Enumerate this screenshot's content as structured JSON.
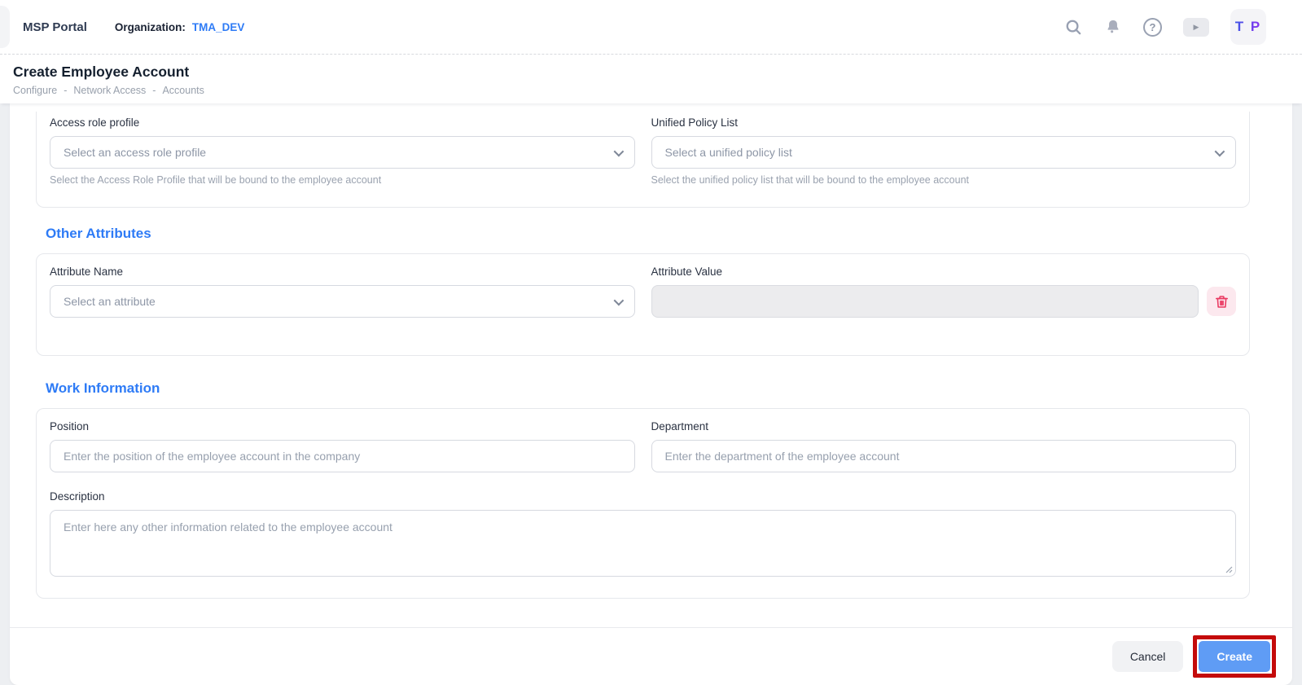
{
  "header": {
    "app_title": "MSP Portal",
    "organization_label": "Organization:",
    "organization_value": "TMA_DEV",
    "avatar_initials": "T P",
    "icons": {
      "help_glyph": "?",
      "play_glyph": "▶"
    }
  },
  "page": {
    "title": "Create Employee Account",
    "breadcrumb": [
      "Configure",
      "Network Access",
      "Accounts"
    ],
    "breadcrumb_separator": "-"
  },
  "form": {
    "access_role": {
      "label": "Access role profile",
      "placeholder": "Select an access role profile",
      "helper": "Select the Access Role Profile that will be bound to the employee account"
    },
    "unified_policy": {
      "label": "Unified Policy List",
      "placeholder": "Select a unified policy list",
      "helper": "Select the unified policy list that will be bound to the employee account"
    },
    "other_attributes": {
      "heading": "Other Attributes",
      "attribute_name": {
        "label": "Attribute Name",
        "placeholder": "Select an attribute"
      },
      "attribute_value": {
        "label": "Attribute Value",
        "value": ""
      }
    },
    "work_information": {
      "heading": "Work Information",
      "position": {
        "label": "Position",
        "placeholder": "Enter the position of the employee account in the company"
      },
      "department": {
        "label": "Department",
        "placeholder": "Enter the department of the employee account"
      },
      "description": {
        "label": "Description",
        "placeholder": "Enter here any other information related to the employee account"
      }
    }
  },
  "footer": {
    "cancel_label": "Cancel",
    "create_label": "Create"
  },
  "colors": {
    "accent_blue": "#2e7bf6",
    "create_button_blue": "#5f9cf5",
    "annotation_red": "#c40b0b",
    "danger_pink": "#ea3a62",
    "page_background": "#edeff2"
  }
}
